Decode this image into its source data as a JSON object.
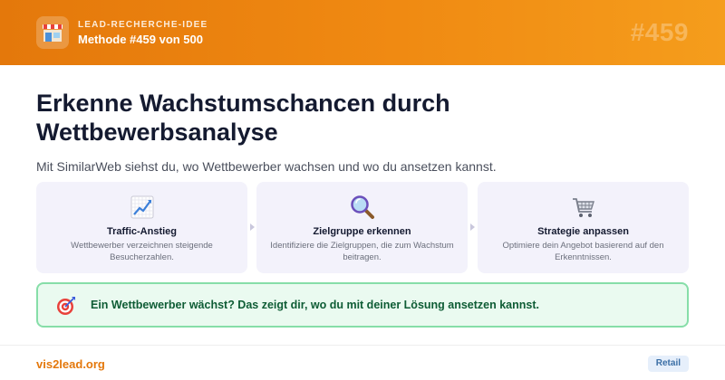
{
  "header": {
    "logo_icon": "shop-icon",
    "kicker": "LEAD-RECHERCHE-IDEE",
    "method_label": "Methode #459 von 500",
    "number_badge": "#459",
    "gradient_start": "#e4780b",
    "gradient_end": "#f59d1c"
  },
  "main": {
    "title": "Erkenne Wachstumschancen durch Wettbewerbsanalyse",
    "subtitle": "Mit SimilarWeb siehst du, wo Wettbewerber wachsen und wo du ansetzen kannst."
  },
  "steps": [
    {
      "icon": "chart-increasing-icon",
      "title": "Traffic-Anstieg",
      "description": "Wettbewerber verzeichnen steigende Besucherzahlen."
    },
    {
      "icon": "magnifier-icon",
      "title": "Zielgruppe erkennen",
      "description": "Identifiziere die Zielgruppen, die zum Wachstum beitragen."
    },
    {
      "icon": "shopping-cart-icon",
      "title": "Strategie anpassen",
      "description": "Optimiere dein Angebot basierend auf den Erkenntnissen."
    }
  ],
  "callout": {
    "icon": "target-icon",
    "text": "Ein Wettbewerber wächst? Das zeigt dir, wo du mit deiner Lösung ansetzen kannst.",
    "border_color": "#86dea8",
    "background": "#eafaf0"
  },
  "footer": {
    "site": "vis2lead.org",
    "tag": "Retail"
  }
}
